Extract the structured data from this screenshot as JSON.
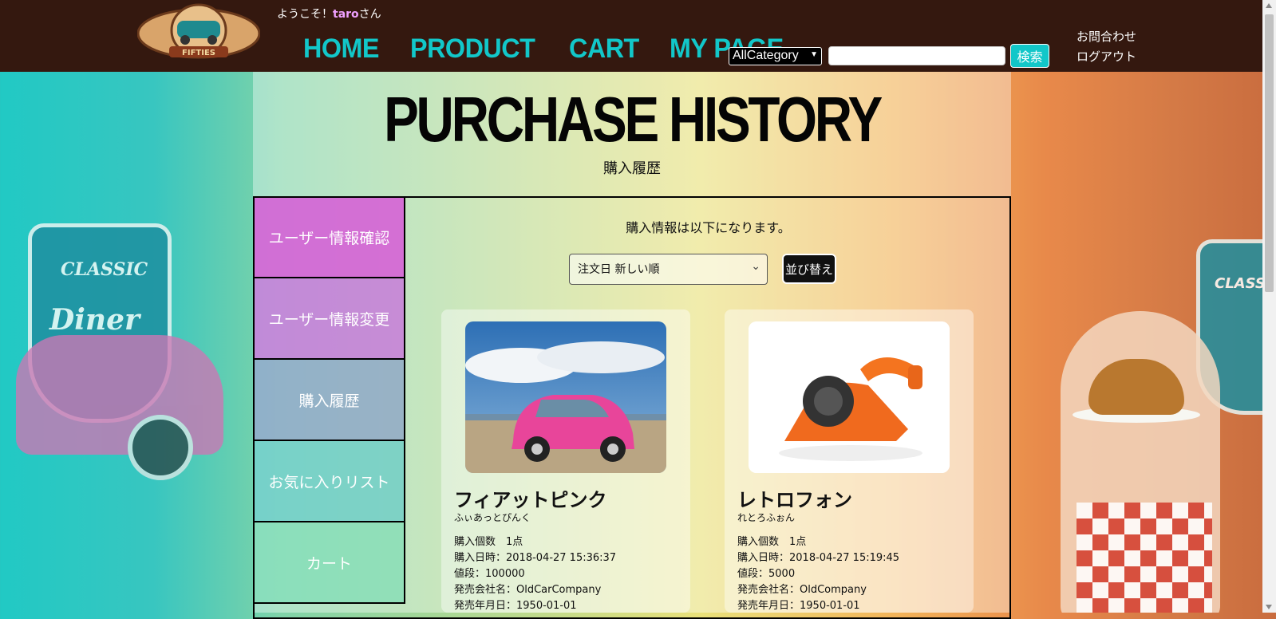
{
  "header": {
    "welcome_prefix": "ようこそ！",
    "username": "taro",
    "welcome_suffix": "さん",
    "logo_text": "FIFTIES",
    "nav": [
      "HOME",
      "PRODUCT",
      "CART",
      "MY PAGE"
    ],
    "category_select": "AllCategory",
    "search_placeholder": "",
    "search_button": "検索",
    "contact_link": "お問合わせ",
    "logout_link": "ログアウト"
  },
  "page": {
    "title": "PURCHASE HISTORY",
    "subtitle": "購入履歴",
    "info_text": "購入情報は以下になります。",
    "sort_select": "注文日 新しい順",
    "sort_button": "並び替え"
  },
  "sidebar": {
    "items": [
      "ユーザー情報確認",
      "ユーザー情報変更",
      "購入履歴",
      "お気に入りリスト",
      "カート"
    ]
  },
  "products": [
    {
      "name": "フィアットピンク",
      "kana": "ふぃあっとぴんく",
      "quantity": "購入個数　1点",
      "date": "購入日時：2018-04-27 15:36:37",
      "price": "値段：100000",
      "company": "発売会社名：OldCarCompany",
      "release": "発売年月日：1950-01-01",
      "image": "pink-fiat-car-photo"
    },
    {
      "name": "レトロフォン",
      "kana": "れとろふぉん",
      "quantity": "購入個数　1点",
      "date": "購入日時：2018-04-27 15:19:45",
      "price": "値段：5000",
      "company": "発売会社名：OldCompany",
      "release": "発売年月日：1950-01-01",
      "image": "orange-retro-phone-photo"
    }
  ],
  "background": {
    "sign_left_top": "CLASSIC",
    "sign_left_bottom": "Diner",
    "sign_right": "CLASS"
  },
  "colors": {
    "header_bg": "#34180f",
    "nav": "#12c7c9",
    "accent_pink": "#d75ad7"
  }
}
